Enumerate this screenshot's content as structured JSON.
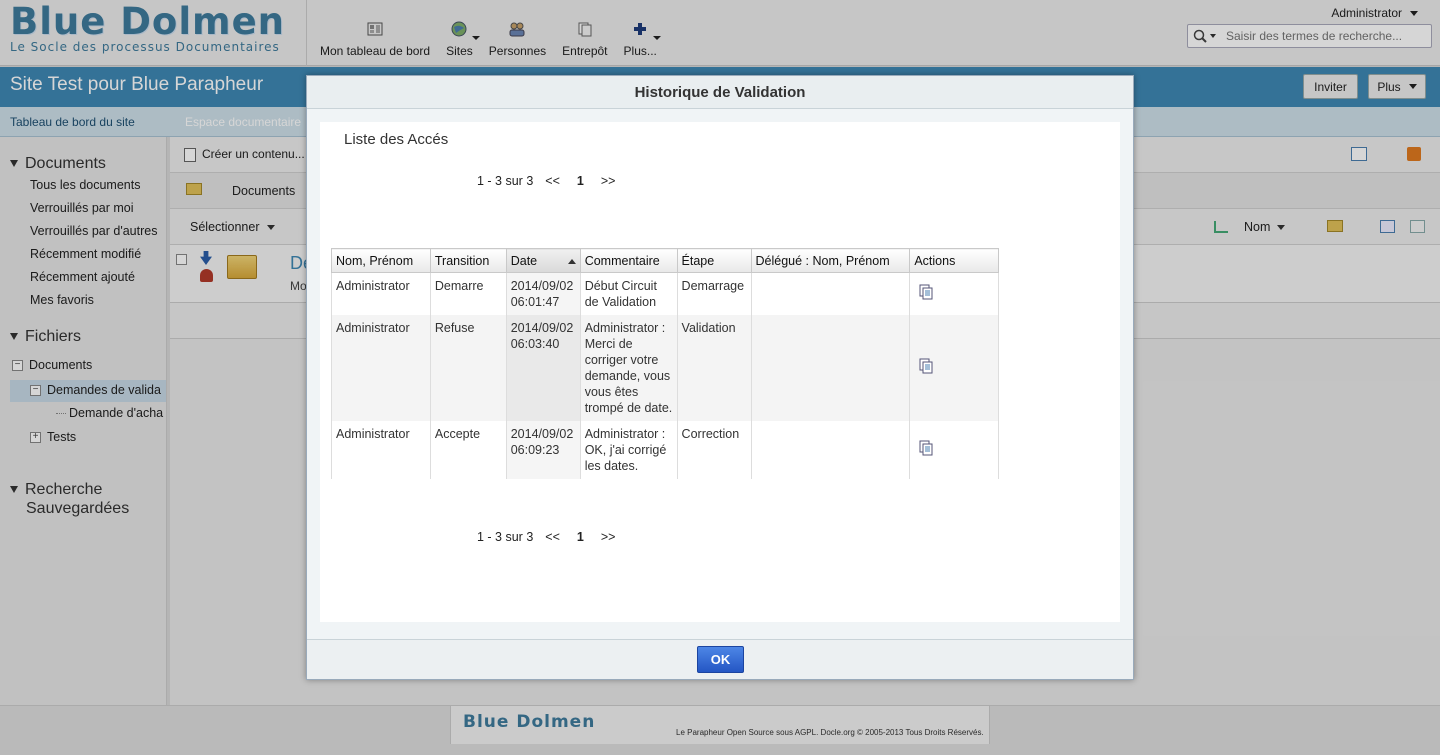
{
  "header": {
    "logo_title": "Blue Dolmen",
    "logo_subtitle": "Le Socle des processus Documentaires",
    "nav": [
      {
        "label": "Mon tableau de bord",
        "icon": "dashboard-icon"
      },
      {
        "label": "Sites",
        "icon": "globe-icon"
      },
      {
        "label": "Personnes",
        "icon": "people-icon"
      },
      {
        "label": "Entrepôt",
        "icon": "repository-icon"
      },
      {
        "label": "Plus...",
        "icon": "plus-icon"
      }
    ],
    "user": "Administrator",
    "search_placeholder": "Saisir des termes de recherche..."
  },
  "site": {
    "title": "Site Test pour Blue Parapheur",
    "invite_label": "Inviter",
    "more_label": "Plus",
    "subnav": [
      "Tableau de bord du site",
      "Espace documentaire"
    ]
  },
  "sidebar": {
    "documents_heading": "Documents",
    "document_filters": [
      "Tous les documents",
      "Verrouillés par moi",
      "Verrouillés par d'autres",
      "Récemment modifié",
      "Récemment ajouté",
      "Mes favoris"
    ],
    "files_heading": "Fichiers",
    "tree": {
      "root": "Documents",
      "child1": "Demandes de valida",
      "grandchild": "Demande d'acha",
      "child2": "Tests"
    },
    "saved_search_line1": "Recherche",
    "saved_search_line2": "Sauvegardées"
  },
  "main": {
    "create_content": "Créer un contenu...",
    "breadcrumb_documents": "Documents",
    "select_label": "Sélectionner",
    "sort_label": "Nom",
    "row_name_partial": "De",
    "row_desc_partial": "Mo"
  },
  "dialog": {
    "title": "Historique de Validation",
    "list_title": "Liste des Accés",
    "pager": {
      "range": "1 - 3 sur 3",
      "prev": "<<",
      "current": "1",
      "next": ">>"
    },
    "columns": [
      "Nom, Prénom",
      "Transition",
      "Date",
      "Commentaire",
      "Étape",
      "Délégué : Nom, Prénom",
      "Actions"
    ],
    "rows": [
      {
        "name": "Administrator",
        "transition": "Demarre",
        "date1": "2014/09/02",
        "date2": "06:01:47",
        "comment": "Début Circuit de Validation",
        "step": "Demarrage",
        "delegate": ""
      },
      {
        "name": "Administrator",
        "transition": "Refuse",
        "date1": "2014/09/02",
        "date2": "06:03:40",
        "comment": "Administrator : Merci de corriger votre demande, vous vous êtes trompé de date.",
        "step": "Validation",
        "delegate": ""
      },
      {
        "name": "Administrator",
        "transition": "Accepte",
        "date1": "2014/09/02",
        "date2": "06:09:23",
        "comment": "Administrator : OK, j'ai corrigé les dates.",
        "step": "Correction",
        "delegate": ""
      }
    ],
    "ok_label": "OK"
  },
  "footer": {
    "logo": "Blue Dolmen",
    "text": "Le Parapheur Open Source sous AGPL. Docle.org © 2005-2013 Tous Droits Réservés."
  },
  "colors": {
    "brand": "#3e7b9c",
    "site_bar": "#3f88b4",
    "ok_button": "#2f66d0"
  }
}
